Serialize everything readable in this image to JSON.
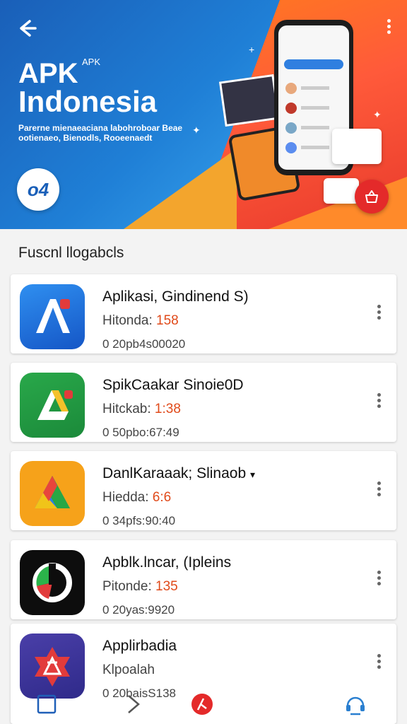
{
  "header": {
    "title_line1": "APK",
    "title_small": "APK",
    "title_line2": "Indonesia",
    "subtitle": "Parerne mienaeaciana labohroboar Beae ootienaeo, Bienodls, Rooeenaedt",
    "logo_text": "o4"
  },
  "section_title": "Fuscnl llogabcls",
  "apps": [
    {
      "name": "Aplikasi, Gindinend S)",
      "meta_label": "Hitonda: ",
      "meta_value": "158",
      "date": "0 20pb4s00020",
      "color": "#1f6fe0"
    },
    {
      "name": "SpikCaakar Sinoie0D",
      "meta_label": "Hitckab: ",
      "meta_value": "1:38",
      "date": "0 50pbo:67:49",
      "color": "#23a046"
    },
    {
      "name": "DanlKaraaak; Slinaob",
      "meta_label": "Hiedda: ",
      "meta_value": "6:6",
      "date": "0 34pfs:90:40",
      "color": "#f6a21a"
    },
    {
      "name": "Apblk.lncar, (Ipleins",
      "meta_label": "Pitonde: ",
      "meta_value": "135",
      "date": "0 20yas:9920",
      "color": "#0d0d0d"
    },
    {
      "name": "Applirbadia",
      "meta_label": "Klpoalah",
      "meta_value": "",
      "date": "0 20baisS138",
      "color": "#3a35a0"
    }
  ],
  "colors": {
    "accent": "#e42a2a",
    "primary": "#1a5fb8",
    "highlight": "#e04a1a"
  },
  "icons": {
    "back": "arrow-left-icon",
    "menu": "kebab-menu-icon",
    "cart": "shopping-basket-icon",
    "nav_home": "square-icon",
    "nav_next": "chevron-right-icon",
    "nav_center": "app-badge-icon",
    "nav_support": "headset-icon"
  }
}
